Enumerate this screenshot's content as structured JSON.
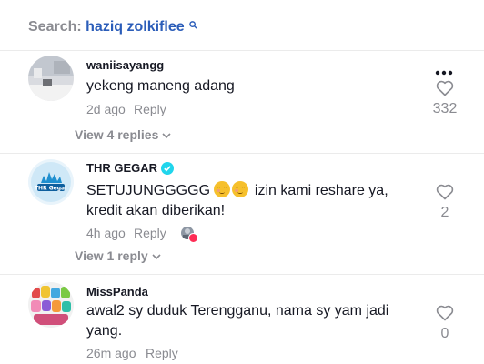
{
  "search": {
    "label": "Search:",
    "query": "haziq zolkiflee"
  },
  "comments": [
    {
      "username": "waniisayangg",
      "text": "yekeng maneng adang",
      "time": "2d ago",
      "reply_label": "Reply",
      "view_replies": "View 4 replies",
      "likes": "332",
      "more_icon": "more-horizontal-icon"
    },
    {
      "username": "THR GEGAR",
      "verified": true,
      "text_before": "SETUJUNGGGGG",
      "emojis": [
        "smiling-face-emoji",
        "smiling-face-emoji"
      ],
      "text_after": "izin kami reshare ya, kredit akan diberikan!",
      "time": "4h ago",
      "reply_label": "Reply",
      "view_replies": "View 1 reply",
      "likes": "2",
      "creator_liked": true
    },
    {
      "username": "MissPanda",
      "text": "awal2 sy duduk Terengganu, nama sy yam jadi yang.",
      "time": "26m ago",
      "reply_label": "Reply",
      "likes": "0"
    }
  ],
  "colors": {
    "accent_link": "#2b5db9",
    "muted": "#8a8b91",
    "verified": "#20d5ec",
    "like_badge": "#fe2c55"
  }
}
